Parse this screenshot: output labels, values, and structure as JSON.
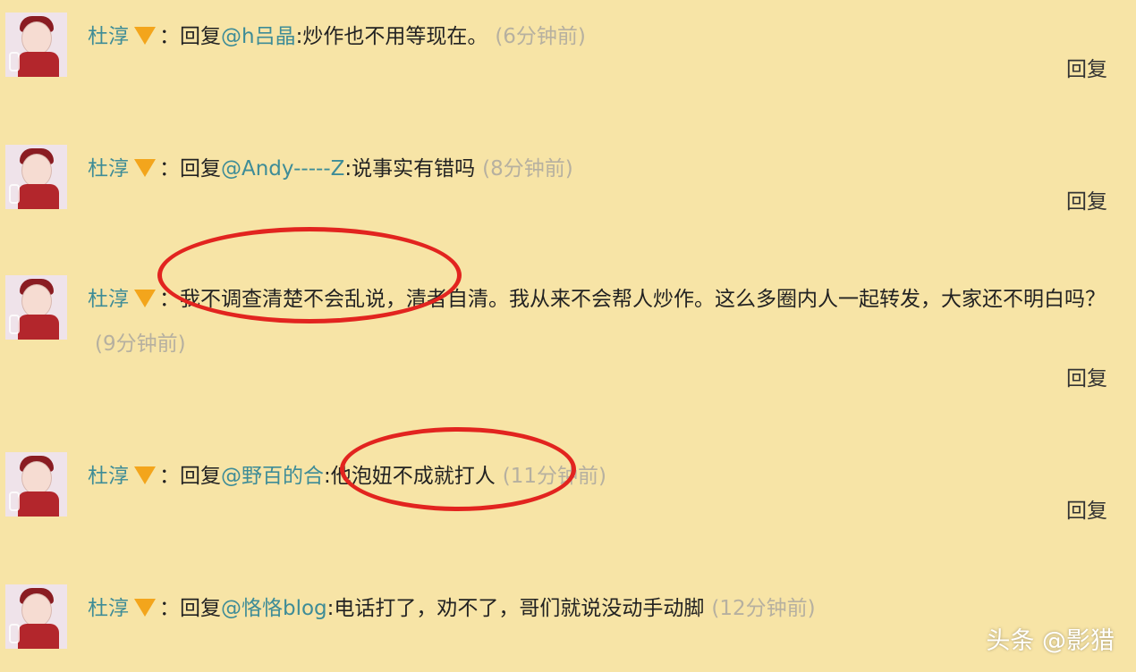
{
  "comments": [
    {
      "username": "杜淳",
      "verified_badge": "V",
      "colon": "：",
      "reply_prefix": "回复",
      "mention": "@h吕晶",
      "separator": ":",
      "text": "炒作也不用等现在。",
      "time": "(6分钟前)",
      "reply_label": "回复"
    },
    {
      "username": "杜淳",
      "verified_badge": "V",
      "colon": "：",
      "reply_prefix": "回复",
      "mention": "@Andy-----Z",
      "separator": ":",
      "text": "说事实有错吗",
      "time": "(8分钟前)",
      "reply_label": "回复"
    },
    {
      "username": "杜淳",
      "verified_badge": "V",
      "colon": "：",
      "text": "我不调查清楚不会乱说，清者自清。我从来不会帮人炒作。这么多圈内人一起转发，大家还不明白吗？",
      "time": "(9分钟前)",
      "reply_label": "回复"
    },
    {
      "username": "杜淳",
      "verified_badge": "V",
      "colon": "：",
      "reply_prefix": "回复",
      "mention": "@野百的合",
      "separator": ":",
      "text": "他泡妞不成就打人",
      "time": "(11分钟前)",
      "reply_label": "回复"
    },
    {
      "username": "杜淳",
      "verified_badge": "V",
      "colon": "：",
      "reply_prefix": "回复",
      "mention": "@恪恪blog",
      "separator": ":",
      "text": "电话打了，劝不了，哥们就说没动手动脚",
      "time": "(12分钟前)"
    }
  ],
  "watermark": "头条 @影猎",
  "colors": {
    "background": "#f7e4a6",
    "username": "#3e8c97",
    "mention": "#3e8c97",
    "time": "#b6b0a0",
    "verified_badge": "#f3a51c",
    "highlight_circle": "#e2241f"
  },
  "icons": {
    "verified_badge": "verified-v-icon",
    "avatar": "user-avatar"
  }
}
